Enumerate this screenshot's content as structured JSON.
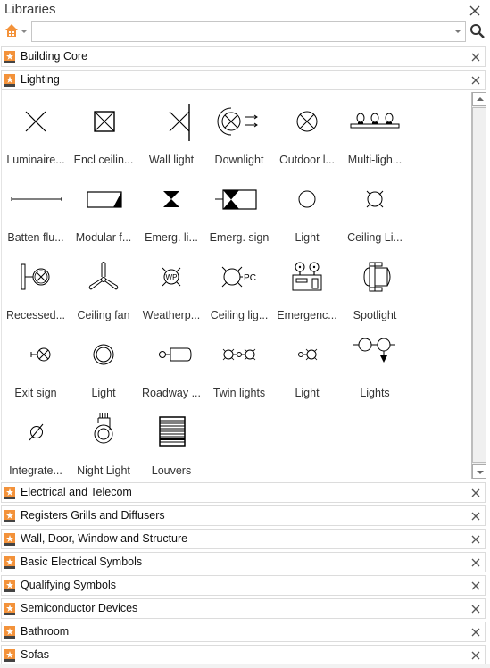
{
  "panel": {
    "title": "Libraries",
    "close_label": "close"
  },
  "toolbar": {
    "home_icon": "home-icon",
    "search_placeholder": "",
    "search_value": "",
    "search_icon": "search-icon"
  },
  "colors": {
    "library_icon": "#f3923a",
    "library_icon_base": "#444444",
    "home_icon": "#f3923a"
  },
  "libraries_top": [
    {
      "label": "Building Core",
      "expanded": false
    },
    {
      "label": "Lighting",
      "expanded": true
    }
  ],
  "lighting_shapes": [
    {
      "label": "Luminaire...",
      "icon": "luminaire-x-icon"
    },
    {
      "label": "Encl ceilin...",
      "icon": "enclosed-ceiling-light-icon"
    },
    {
      "label": "Wall light",
      "icon": "wall-light-icon"
    },
    {
      "label": "Downlight",
      "icon": "downlight-icon"
    },
    {
      "label": "Outdoor l...",
      "icon": "outdoor-light-icon"
    },
    {
      "label": "Multi-ligh...",
      "icon": "multi-light-icon"
    },
    {
      "label": "Batten flu...",
      "icon": "batten-fluorescent-icon"
    },
    {
      "label": "Modular f...",
      "icon": "modular-fluorescent-icon"
    },
    {
      "label": "Emerg. li...",
      "icon": "emergency-light-icon"
    },
    {
      "label": "Emerg. sign",
      "icon": "emergency-sign-icon"
    },
    {
      "label": "Light",
      "icon": "light-circle-icon"
    },
    {
      "label": "Ceiling Li...",
      "icon": "ceiling-light-icon"
    },
    {
      "label": "Recessed...",
      "icon": "recessed-light-icon"
    },
    {
      "label": "Ceiling fan",
      "icon": "ceiling-fan-icon"
    },
    {
      "label": "Weatherp...",
      "icon": "weatherproof-light-icon"
    },
    {
      "label": "Ceiling lig...",
      "icon": "ceiling-light-pc-icon"
    },
    {
      "label": "Emergenc...",
      "icon": "emergency-unit-icon"
    },
    {
      "label": "Spotlight",
      "icon": "spotlight-icon"
    },
    {
      "label": "Exit sign",
      "icon": "exit-sign-icon"
    },
    {
      "label": "Light",
      "icon": "light-double-circle-icon"
    },
    {
      "label": "Roadway ...",
      "icon": "roadway-light-icon"
    },
    {
      "label": "Twin lights",
      "icon": "twin-lights-icon"
    },
    {
      "label": "Light",
      "icon": "light-small-icon"
    },
    {
      "label": "Lights",
      "icon": "lights-arrow-icon"
    },
    {
      "label": "Integrate...",
      "icon": "integrated-light-icon"
    },
    {
      "label": "Night Light",
      "icon": "night-light-icon"
    },
    {
      "label": "Louvers",
      "icon": "louvers-icon"
    }
  ],
  "libraries_bottom": [
    {
      "label": "Electrical and Telecom"
    },
    {
      "label": "Registers Grills and Diffusers"
    },
    {
      "label": "Wall, Door, Window and Structure"
    },
    {
      "label": "Basic Electrical Symbols"
    },
    {
      "label": "Qualifying Symbols"
    },
    {
      "label": "Semiconductor Devices"
    },
    {
      "label": "Bathroom"
    },
    {
      "label": "Sofas"
    }
  ],
  "shape_text": {
    "weatherproof": "WP",
    "photocell": "PC"
  }
}
